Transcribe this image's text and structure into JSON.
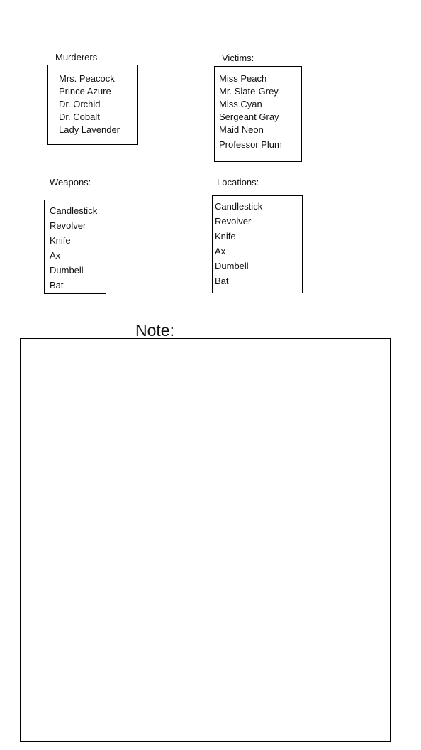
{
  "murderers": {
    "title": "Murderers",
    "items": [
      "Mrs. Peacock",
      "Prince Azure",
      "Dr. Orchid",
      "Dr. Cobalt",
      "Lady Lavender"
    ]
  },
  "victims": {
    "title": "Victims:",
    "items": [
      "Miss Peach",
      "Mr. Slate-Grey",
      "Miss Cyan",
      "Sergeant Gray",
      "Maid Neon",
      "Professor Plum"
    ]
  },
  "weapons": {
    "title": "Weapons:",
    "items": [
      "Candlestick",
      "Revolver",
      "Knife",
      "Ax",
      "Dumbell",
      "Bat"
    ]
  },
  "locations": {
    "title": "Locations:",
    "items": [
      "Candlestick",
      "Revolver",
      "Knife",
      "Ax",
      "Dumbell",
      "Bat"
    ]
  },
  "note": {
    "title": "Note:",
    "content": ""
  }
}
